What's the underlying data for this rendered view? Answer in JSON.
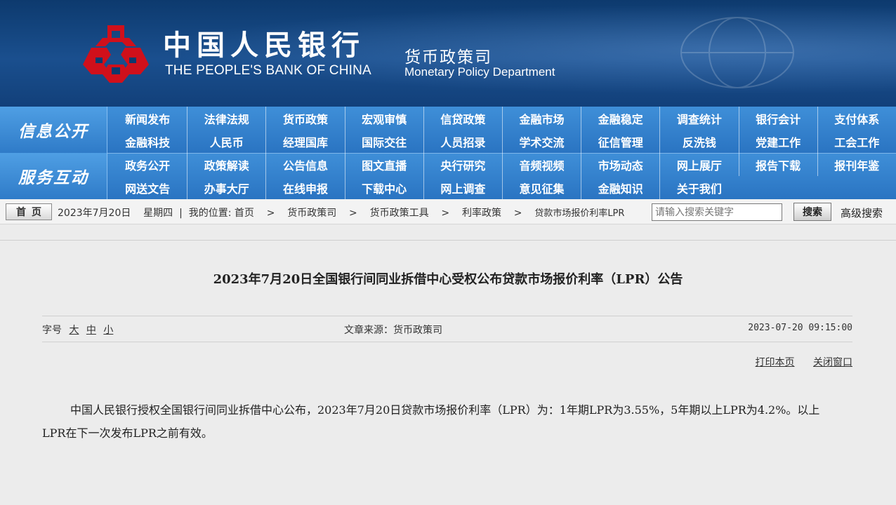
{
  "colors": {
    "banner_bg": "#12407a",
    "nav_bg": "#2f7bc8",
    "page_bg": "#ececec",
    "logo_red": "#d0101b"
  },
  "header": {
    "bank_name_cn": "中国人民银行",
    "bank_name_en": "THE PEOPLE'S BANK OF CHINA",
    "dept_cn": "货币政策司",
    "dept_en": "Monetary Policy Department",
    "logo_icon": "pboc-logo-icon"
  },
  "nav": {
    "info": {
      "title": "信息公开",
      "items": [
        "新闻发布",
        "法律法规",
        "货币政策",
        "宏观审慎",
        "信贷政策",
        "金融市场",
        "金融稳定",
        "调查统计",
        "银行会计",
        "支付体系",
        "金融科技",
        "人民币",
        "经理国库",
        "国际交往",
        "人员招录",
        "学术交流",
        "征信管理",
        "反洗钱",
        "党建工作",
        "工会工作"
      ]
    },
    "service": {
      "title": "服务互动",
      "items": [
        "政务公开",
        "政策解读",
        "公告信息",
        "图文直播",
        "央行研究",
        "音频视频",
        "市场动态",
        "网上展厅",
        "报告下载",
        "报刊年鉴",
        "网送文告",
        "办事大厅",
        "在线申报",
        "下载中心",
        "网上调查",
        "意见征集",
        "金融知识",
        "关于我们"
      ]
    }
  },
  "breadcrumb": {
    "home_label": "首页",
    "date": "2023年7月20日",
    "weekday": "星期四",
    "location_label": "我的位置:",
    "path": [
      "首页",
      "货币政策司",
      "货币政策工具",
      "利率政策",
      "贷款市场报价利率LPR"
    ],
    "separator": ">",
    "search_placeholder": "请输入搜索关键字",
    "search_button": "搜索",
    "advanced_search": "高级搜索"
  },
  "article": {
    "title": "2023年7月20日全国银行间同业拆借中心受权公布贷款市场报价利率（LPR）公告",
    "font_size_label": "字号",
    "font_sizes": [
      "大",
      "中",
      "小"
    ],
    "source": "文章来源：货币政策司",
    "datetime": "2023-07-20 09:15:00",
    "print_label": "打印本页",
    "close_label": "关闭窗口",
    "body": "中国人民银行授权全国银行间同业拆借中心公布，2023年7月20日贷款市场报价利率（LPR）为：1年期LPR为3.55%，5年期以上LPR为4.2%。以上LPR在下一次发布LPR之前有效。"
  }
}
